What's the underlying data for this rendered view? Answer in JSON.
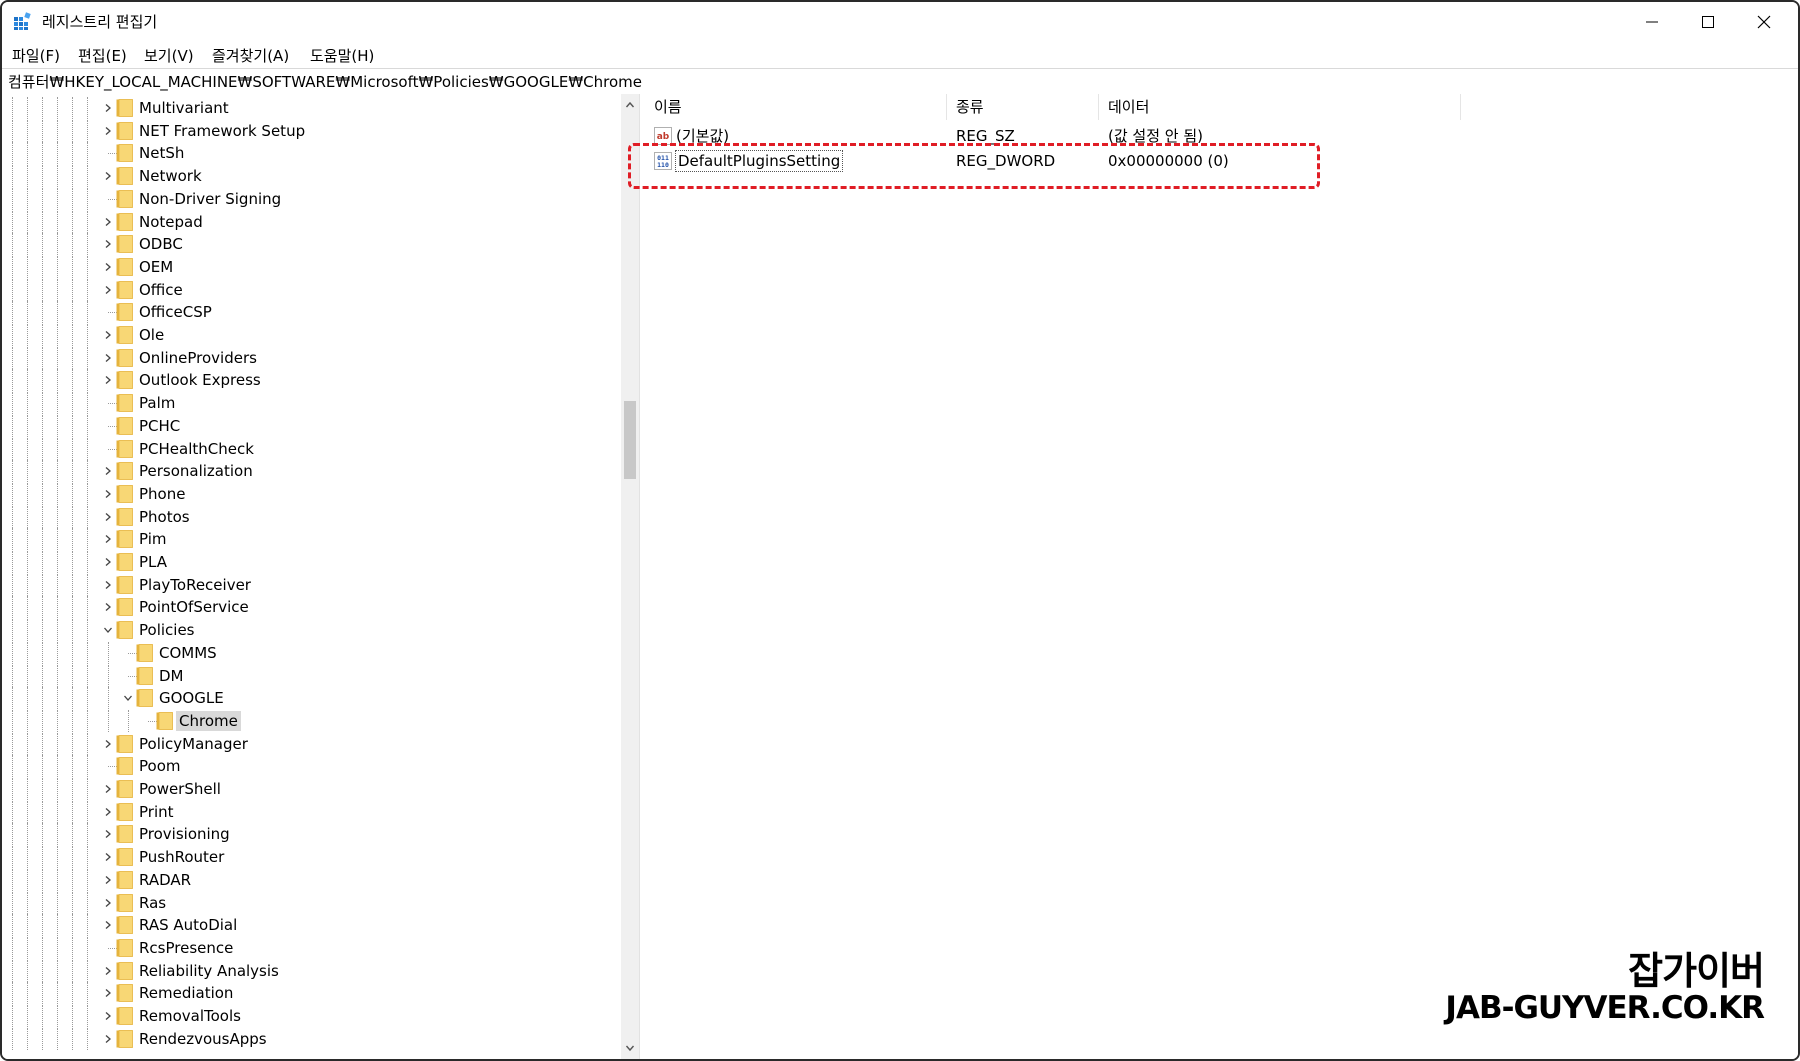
{
  "window": {
    "title": "레지스트리 편집기",
    "controls": [
      "minimize",
      "maximize",
      "close"
    ]
  },
  "menu": [
    {
      "label": "파일(F)"
    },
    {
      "label": "편집(E)"
    },
    {
      "label": "보기(V)"
    },
    {
      "label": "즐겨찾기(A)"
    },
    {
      "label": "도움말(H)"
    }
  ],
  "address": {
    "path": "컴퓨터₩HKEY_LOCAL_MACHINE₩SOFTWARE₩Microsoft₩Policies₩GOOGLE₩Chrome"
  },
  "tree": {
    "items": [
      {
        "label": "Multivariant",
        "depth": 0,
        "expander": "collapsed"
      },
      {
        "label": "NET Framework Setup",
        "depth": 0,
        "expander": "collapsed"
      },
      {
        "label": "NetSh",
        "depth": 0,
        "expander": "none"
      },
      {
        "label": "Network",
        "depth": 0,
        "expander": "collapsed"
      },
      {
        "label": "Non-Driver Signing",
        "depth": 0,
        "expander": "none"
      },
      {
        "label": "Notepad",
        "depth": 0,
        "expander": "collapsed"
      },
      {
        "label": "ODBC",
        "depth": 0,
        "expander": "collapsed"
      },
      {
        "label": "OEM",
        "depth": 0,
        "expander": "collapsed"
      },
      {
        "label": "Office",
        "depth": 0,
        "expander": "collapsed"
      },
      {
        "label": "OfficeCSP",
        "depth": 0,
        "expander": "none"
      },
      {
        "label": "Ole",
        "depth": 0,
        "expander": "collapsed"
      },
      {
        "label": "OnlineProviders",
        "depth": 0,
        "expander": "collapsed"
      },
      {
        "label": "Outlook Express",
        "depth": 0,
        "expander": "collapsed"
      },
      {
        "label": "Palm",
        "depth": 0,
        "expander": "none"
      },
      {
        "label": "PCHC",
        "depth": 0,
        "expander": "none"
      },
      {
        "label": "PCHealthCheck",
        "depth": 0,
        "expander": "none"
      },
      {
        "label": "Personalization",
        "depth": 0,
        "expander": "collapsed"
      },
      {
        "label": "Phone",
        "depth": 0,
        "expander": "collapsed"
      },
      {
        "label": "Photos",
        "depth": 0,
        "expander": "collapsed"
      },
      {
        "label": "Pim",
        "depth": 0,
        "expander": "collapsed"
      },
      {
        "label": "PLA",
        "depth": 0,
        "expander": "collapsed"
      },
      {
        "label": "PlayToReceiver",
        "depth": 0,
        "expander": "collapsed"
      },
      {
        "label": "PointOfService",
        "depth": 0,
        "expander": "collapsed"
      },
      {
        "label": "Policies",
        "depth": 0,
        "expander": "expanded"
      },
      {
        "label": "COMMS",
        "depth": 1,
        "expander": "none"
      },
      {
        "label": "DM",
        "depth": 1,
        "expander": "none"
      },
      {
        "label": "GOOGLE",
        "depth": 1,
        "expander": "expanded"
      },
      {
        "label": "Chrome",
        "depth": 2,
        "expander": "none",
        "selected": true
      },
      {
        "label": "PolicyManager",
        "depth": 0,
        "expander": "collapsed"
      },
      {
        "label": "Poom",
        "depth": 0,
        "expander": "none"
      },
      {
        "label": "PowerShell",
        "depth": 0,
        "expander": "collapsed"
      },
      {
        "label": "Print",
        "depth": 0,
        "expander": "collapsed"
      },
      {
        "label": "Provisioning",
        "depth": 0,
        "expander": "collapsed"
      },
      {
        "label": "PushRouter",
        "depth": 0,
        "expander": "collapsed"
      },
      {
        "label": "RADAR",
        "depth": 0,
        "expander": "collapsed"
      },
      {
        "label": "Ras",
        "depth": 0,
        "expander": "collapsed"
      },
      {
        "label": "RAS AutoDial",
        "depth": 0,
        "expander": "collapsed"
      },
      {
        "label": "RcsPresence",
        "depth": 0,
        "expander": "none"
      },
      {
        "label": "Reliability Analysis",
        "depth": 0,
        "expander": "collapsed"
      },
      {
        "label": "Remediation",
        "depth": 0,
        "expander": "collapsed"
      },
      {
        "label": "RemovalTools",
        "depth": 0,
        "expander": "collapsed"
      },
      {
        "label": "RendezvousApps",
        "depth": 0,
        "expander": "collapsed"
      }
    ]
  },
  "values": {
    "columns": [
      {
        "label": "이름"
      },
      {
        "label": "종류"
      },
      {
        "label": "데이터"
      }
    ],
    "rows": [
      {
        "icon": "string-value-icon",
        "name": "(기본값)",
        "type": "REG_SZ",
        "data": "(값 설정 안 됨)"
      },
      {
        "icon": "binary-value-icon",
        "name": "DefaultPluginsSetting",
        "type": "REG_DWORD",
        "data": "0x00000000 (0)",
        "focused": true
      }
    ]
  },
  "watermark": {
    "korean": "잡가이버",
    "english": "JAB-GUYVER.CO.KR"
  },
  "colors": {
    "folder": "#f8d775",
    "folder_dark": "#e5b33c",
    "selection": "#d9d9d9",
    "annotation": "#e01d25"
  }
}
